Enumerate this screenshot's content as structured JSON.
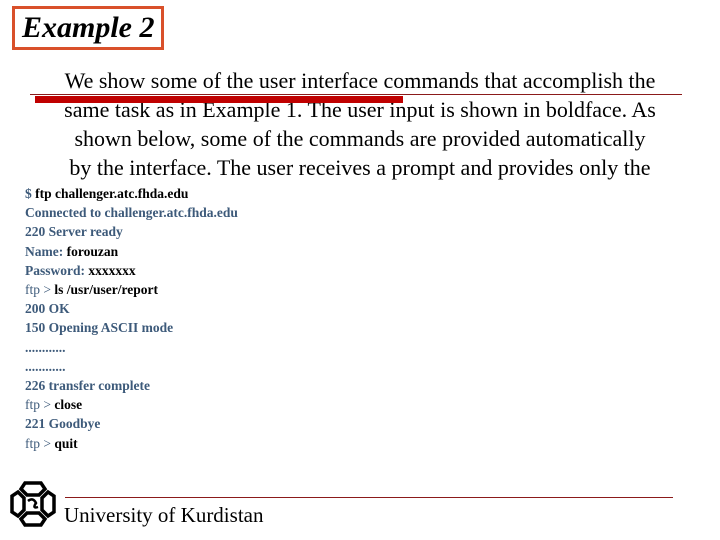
{
  "title": "Example 2",
  "colors": {
    "title_border": "#d9502a",
    "underline": "#c00000",
    "footer_rule": "#8b1a1a",
    "system_text": "#3d5a7a",
    "user_text": "#000000"
  },
  "paragraph": {
    "lines": [
      "We show some of the user interface commands that accomplish the",
      "same task as in Example 1. The user input is shown in boldface. As",
      "shown below, some of the commands are provided automatically",
      "by the interface. The user receives a prompt and provides only the"
    ]
  },
  "terminal": {
    "lines": [
      {
        "prompt": "$ ",
        "input": "ftp challenger.atc.fhda.edu",
        "output": ""
      },
      {
        "prompt": "",
        "input": "",
        "output": "Connected to challenger.atc.fhda.edu"
      },
      {
        "prompt": "",
        "input": "",
        "output": "220 Server ready"
      },
      {
        "prompt": "Name: ",
        "input": "forouzan",
        "output": ""
      },
      {
        "prompt": "Password: ",
        "input": "xxxxxxx",
        "output": ""
      },
      {
        "prompt": "ftp > ",
        "input": "ls /usr/user/report",
        "output": ""
      },
      {
        "prompt": "",
        "input": "",
        "output": "200 OK"
      },
      {
        "prompt": "",
        "input": "",
        "output": "150 Opening ASCII mode"
      },
      {
        "prompt": "",
        "input": "",
        "output": "............"
      },
      {
        "prompt": "",
        "input": "",
        "output": "............"
      },
      {
        "prompt": "",
        "input": "",
        "output": "226 transfer complete"
      },
      {
        "prompt": "ftp > ",
        "input": "close",
        "output": ""
      },
      {
        "prompt": "",
        "input": "",
        "output": "221 Goodbye"
      },
      {
        "prompt": "ftp > ",
        "input": "quit",
        "output": ""
      }
    ]
  },
  "footer": {
    "institution": "University of Kurdistan",
    "logo_icon": "university-logo-icon"
  }
}
